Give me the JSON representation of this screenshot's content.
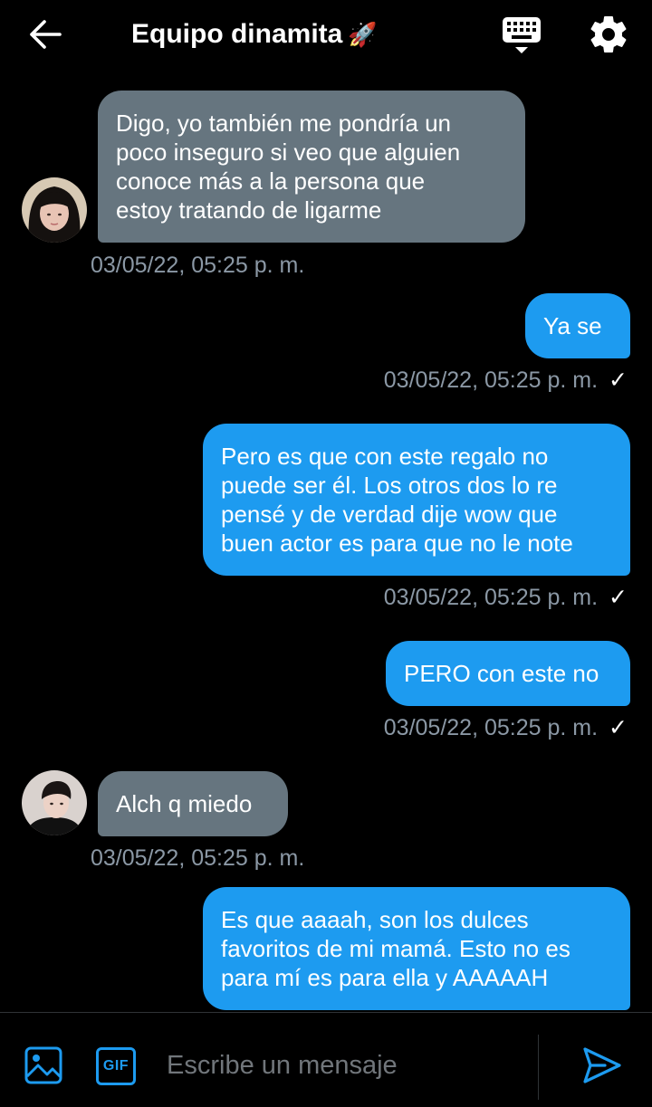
{
  "header": {
    "title": "Equipo dinamita",
    "title_emoji": "🚀",
    "back_icon": "arrow-left-icon",
    "keyboard_icon": "keyboard-icon",
    "settings_icon": "gear-icon"
  },
  "messages": [
    {
      "direction": "in",
      "text": "Digo, yo también me pondría un\npoco inseguro si veo que alguien\nconoce más a la persona que\nestoy tratando de ligarme",
      "timestamp": "03/05/22, 05:25 p. m."
    },
    {
      "direction": "out",
      "text": "Ya se",
      "timestamp": "03/05/22, 05:25 p. m.",
      "status": "✓"
    },
    {
      "direction": "out",
      "text": "Pero es que con este regalo no\npuede ser él. Los otros dos lo re\npensé y de verdad dije wow que\nbuen actor es para que no le note",
      "timestamp": "03/05/22, 05:25 p. m.",
      "status": "✓"
    },
    {
      "direction": "out",
      "text": "PERO con este no",
      "timestamp": "03/05/22, 05:25 p. m.",
      "status": "✓"
    },
    {
      "direction": "in",
      "text": "Alch q miedo",
      "timestamp": "03/05/22, 05:25 p. m."
    },
    {
      "direction": "out",
      "text": "Es que aaaah, son los dulces\nfavoritos de mi mamá. Esto no es\npara mí es para ella y AAAAAH"
    }
  ],
  "composer": {
    "placeholder": "Escribe un mensaje",
    "gif_label": "GIF",
    "image_icon": "image-icon",
    "send_icon": "send-icon"
  },
  "colors": {
    "background": "#000000",
    "incoming_bubble": "#66757f",
    "outgoing_bubble": "#1d9bf0",
    "timestamp": "#8b98a5",
    "accent": "#1d9bf0"
  }
}
